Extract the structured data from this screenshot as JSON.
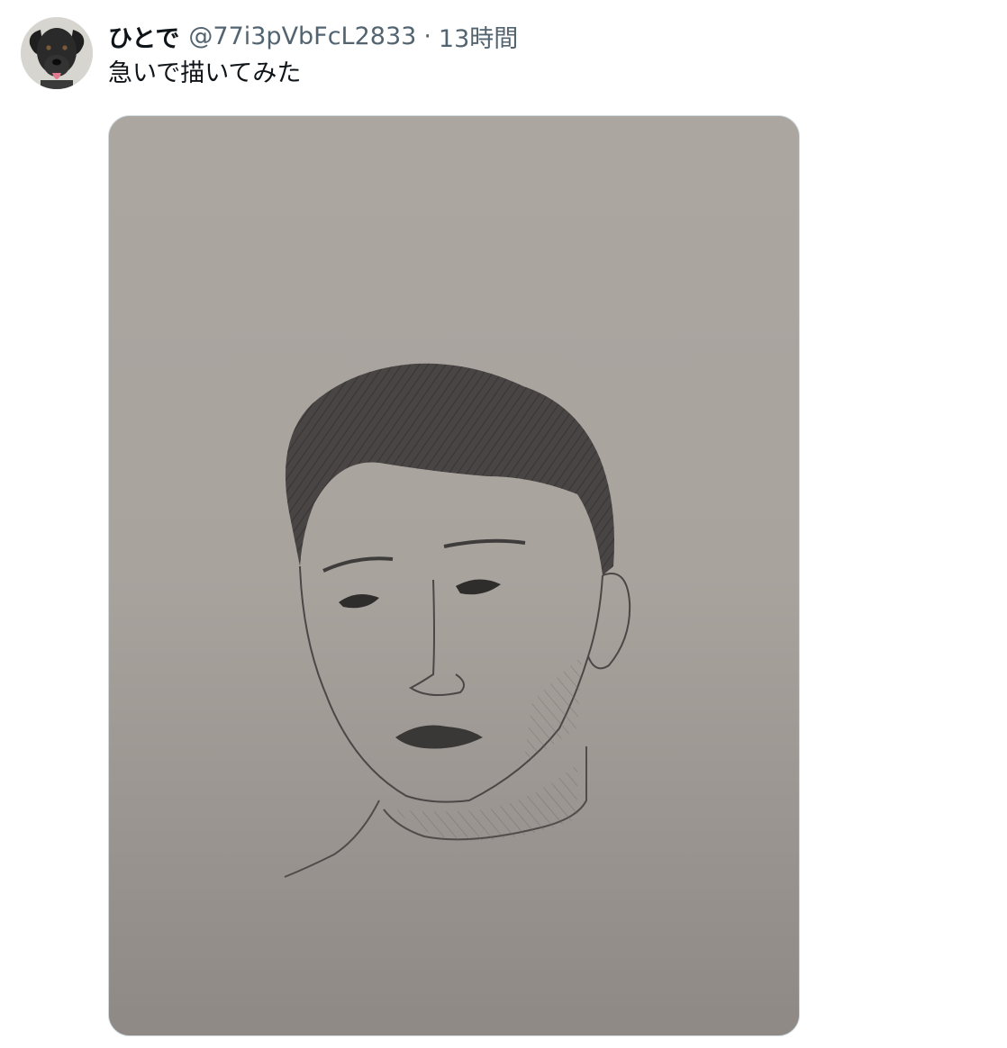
{
  "tweet": {
    "display_name": "ひとで",
    "handle": "@77i3pVbFcL2833",
    "separator": "·",
    "timestamp": "13時間",
    "text": "急いで描いてみた"
  },
  "avatar": {
    "icon": "dog-avatar-icon"
  },
  "media": {
    "icon": "pencil-portrait-sketch-image",
    "paper_color": "#aaa49f",
    "border_color": "#cfd9de"
  },
  "colors": {
    "primary_text": "#0f1419",
    "secondary_text": "#536471"
  }
}
